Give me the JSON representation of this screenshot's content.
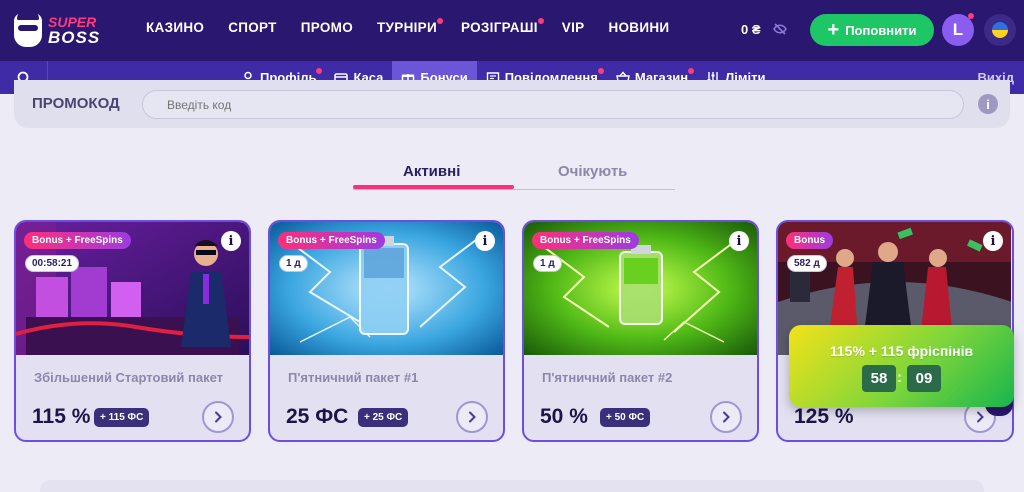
{
  "header": {
    "logo_top": "SUPER",
    "logo_bottom": "BOSS",
    "nav": [
      {
        "label": "КАЗИНО",
        "dot": false
      },
      {
        "label": "СПОРТ",
        "dot": false
      },
      {
        "label": "ПРОМО",
        "dot": false
      },
      {
        "label": "ТУРНІРИ",
        "dot": true
      },
      {
        "label": "РОЗІГРАШІ",
        "dot": true
      },
      {
        "label": "VIP",
        "dot": false
      },
      {
        "label": "НОВИНИ",
        "dot": false
      }
    ],
    "balance": "0 ₴",
    "deposit_label": "Поповнити",
    "avatar_letter": "L"
  },
  "subnav": {
    "items": [
      {
        "label": "Профіль",
        "icon": "user-icon",
        "dot": true
      },
      {
        "label": "Каса",
        "icon": "wallet-icon",
        "dot": false
      },
      {
        "label": "Бонуси",
        "icon": "gift-icon",
        "dot": false,
        "active": true
      },
      {
        "label": "Повідомлення",
        "icon": "message-icon",
        "dot": true
      },
      {
        "label": "Магазин",
        "icon": "basket-icon",
        "dot": true
      },
      {
        "label": "Ліміти",
        "icon": "sliders-icon",
        "dot": false
      }
    ],
    "exit_label": "Вихід"
  },
  "promo": {
    "label": "ПРОМОКОД",
    "placeholder": "Введіть код"
  },
  "tabs": {
    "active": "Активні",
    "pending": "Очікують"
  },
  "cards": [
    {
      "type": "Bonus + FreeSpins",
      "time": "00:58:21",
      "title": "Збільшений Стартовий пакет",
      "value": "115 %",
      "fs": "+ 115 ФС"
    },
    {
      "type": "Bonus + FreeSpins",
      "time": "1 д",
      "title": "П'ятничний пакет #1",
      "value": "25 ФС",
      "fs": "+ 25 ФС"
    },
    {
      "type": "Bonus + FreeSpins",
      "time": "1 д",
      "title": "П'ятничний пакет #2",
      "value": "50 %",
      "fs": "+ 50 ФС"
    },
    {
      "type": "Bonus",
      "time": "582 д",
      "title": "",
      "value": "125 %",
      "fs": ""
    }
  ],
  "popup": {
    "text": "115% + 115 фріспінів",
    "minutes": "58",
    "seconds": "09"
  },
  "colors": {
    "header_bg": "#2a1770",
    "subnav_bg": "#3f2ba6",
    "accent_pink": "#ff2e7a",
    "deposit_green": "#1ec766",
    "card_border": "#6c4ee0"
  }
}
